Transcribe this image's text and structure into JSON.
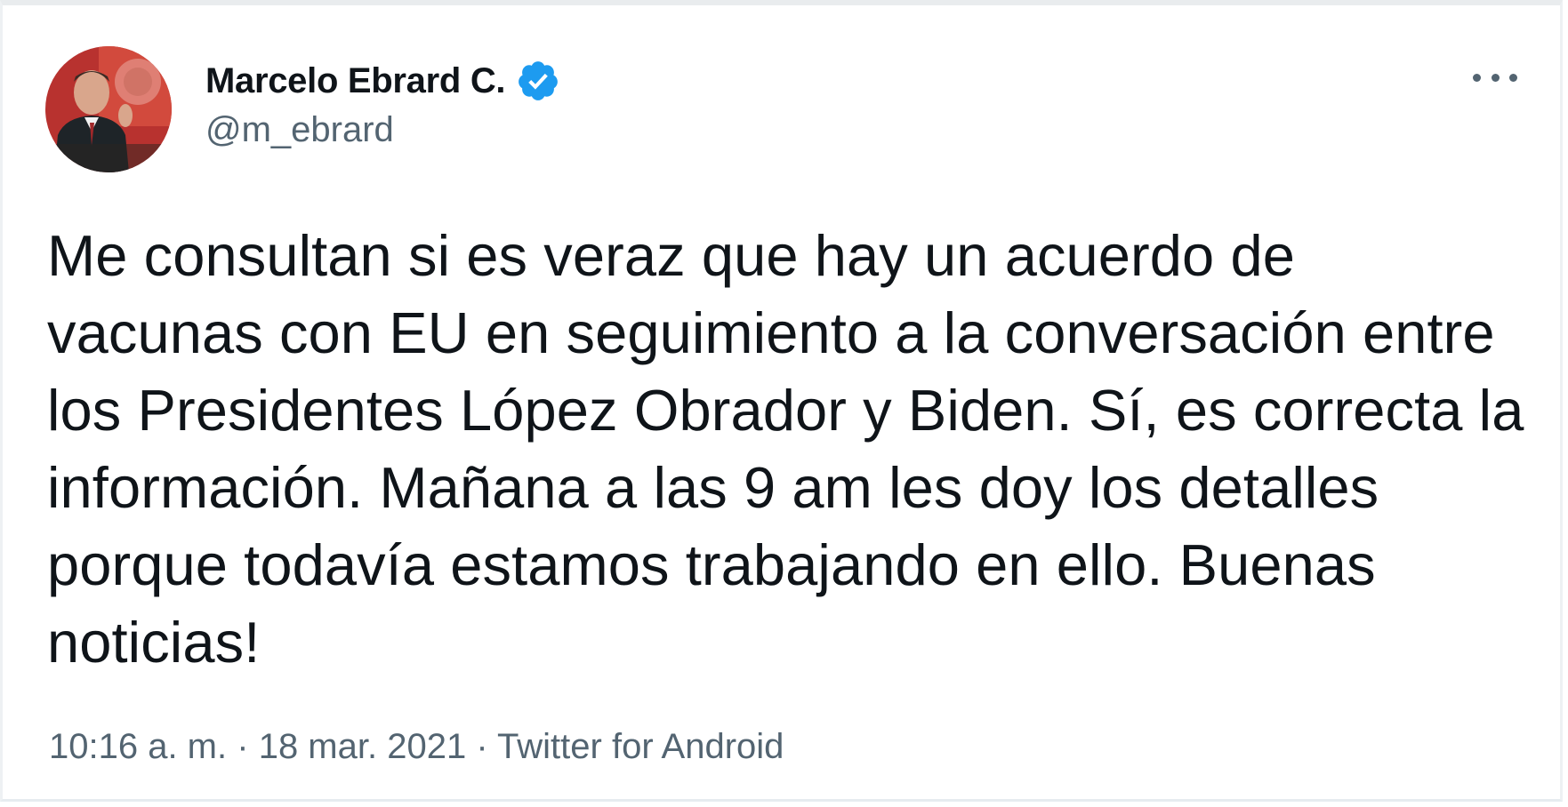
{
  "author": {
    "name": "Marcelo Ebrard C.",
    "handle": "@m_ebrard",
    "verified": true,
    "verified_color": "#1d9bf0"
  },
  "tweet": {
    "text": "Me consultan si es veraz que hay un acuerdo de\nvacunas con EU en seguimiento a la conversación entre\nlos Presidentes López Obrador y Biden. Sí, es correcta la\ninformación. Mañana a las 9 am les doy los detalles\nporque todavía estamos trabajando en ello. Buenas\nnoticias!",
    "time": "10:16 a. m.",
    "separator": "·",
    "date": "18 mar. 2021",
    "source": "Twitter for Android"
  },
  "icons": {
    "more": "more-horizontal-icon",
    "verified": "verified-badge-icon"
  },
  "colors": {
    "text": "#0f1419",
    "secondary": "#536471",
    "border": "#e6ecf0"
  }
}
